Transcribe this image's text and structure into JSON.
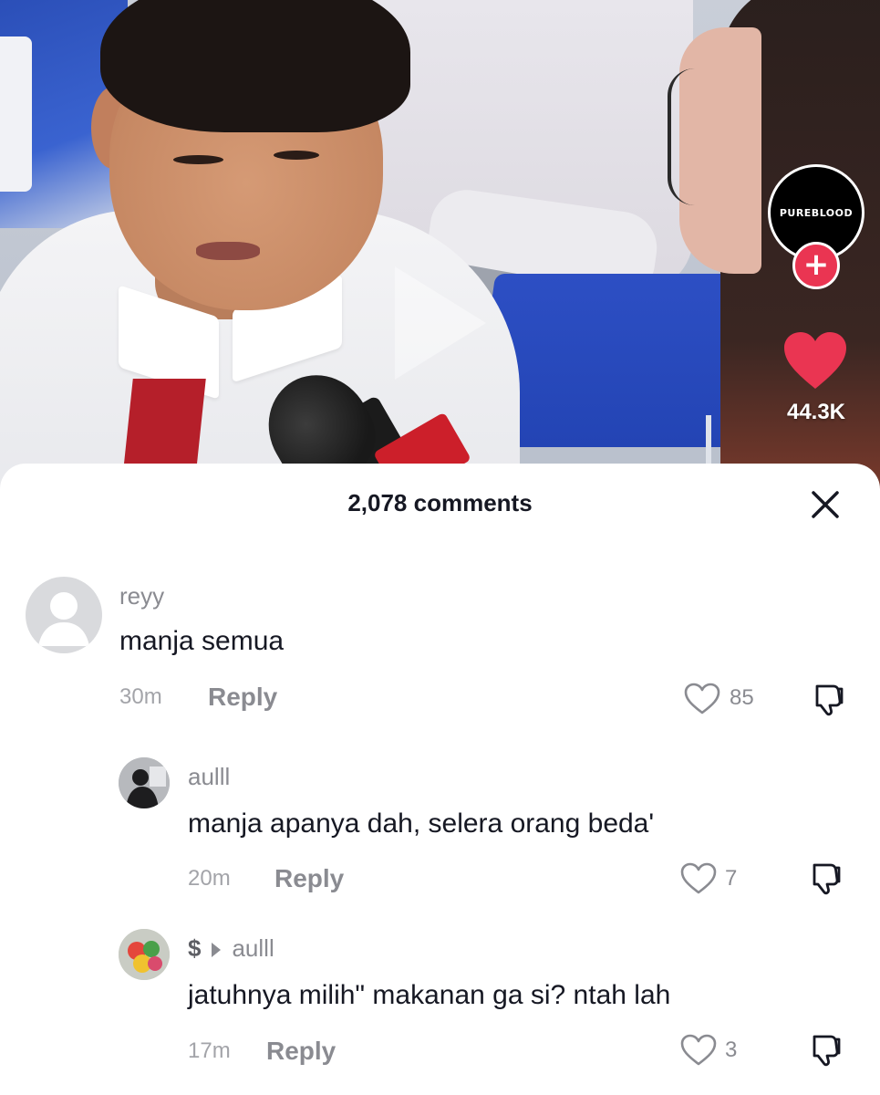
{
  "video": {
    "creator_badge": "PUREBLOOD",
    "like_count": "44.3K",
    "icons": {
      "follow": "plus-icon",
      "like": "heart-icon",
      "play": "play-icon"
    }
  },
  "comments_panel": {
    "title": "2,078 comments",
    "close_icon": "close-icon",
    "comments": [
      {
        "user": "reyy",
        "text": "manja semua",
        "time": "30m",
        "reply_label": "Reply",
        "likes": "85"
      },
      {
        "user": "aulll",
        "text": "manja apanya dah, selera orang beda'",
        "time": "20m",
        "reply_label": "Reply",
        "likes": "7"
      },
      {
        "user": "$",
        "reply_to": "aulll",
        "text": "jatuhnya milih\" makanan ga si? ntah lah",
        "time": "17m",
        "reply_label": "Reply",
        "likes": "3"
      }
    ]
  },
  "colors": {
    "like_red": "#ea3552",
    "text_primary": "#161823",
    "text_secondary": "#8a8b91"
  }
}
